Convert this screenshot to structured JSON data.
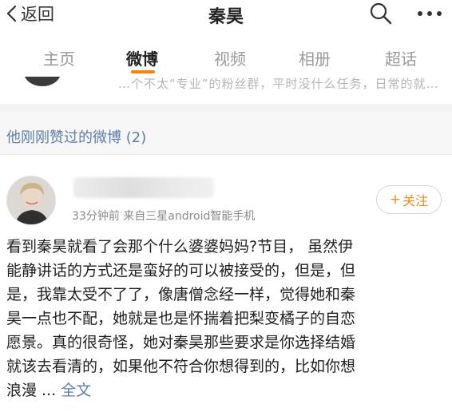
{
  "topbar": {
    "back_label": "返回",
    "title": "秦昊"
  },
  "tabs": [
    {
      "label": "主页",
      "active": false
    },
    {
      "label": "微博",
      "active": true
    },
    {
      "label": "视频",
      "active": false
    },
    {
      "label": "相册",
      "active": false
    },
    {
      "label": "超话",
      "active": false
    }
  ],
  "prev_post": {
    "snippet": "…个不太“专业”的粉丝群，平时没什么任务，日常的就…"
  },
  "section": {
    "label": "他刚刚赞过的微博 (2)"
  },
  "post": {
    "meta": "33分钟前  来自三星android智能手机",
    "follow_label": "关注",
    "lines": [
      "看到秦昊就看了会那个什么婆婆妈妈?节目，  虽然伊",
      "能静讲话的方式还是蛮好的可以被接受的，但是，但",
      "是，我靠太受不了了，像唐僧念经一样，觉得她和秦",
      "昊一点也不配，她就是也是怀揣着把梨变橘子的自恋",
      "愿景。真的很奇怪，她对秦昊那些要求是你选择结婚",
      "就该去看清的，如果他不符合你想得到的，比如你想"
    ],
    "last_line_text": "浪漫 ... ",
    "fulltext_label": "全文"
  },
  "colors": {
    "accent_orange": "#ff8200",
    "link_blue": "#5b7fa8"
  }
}
